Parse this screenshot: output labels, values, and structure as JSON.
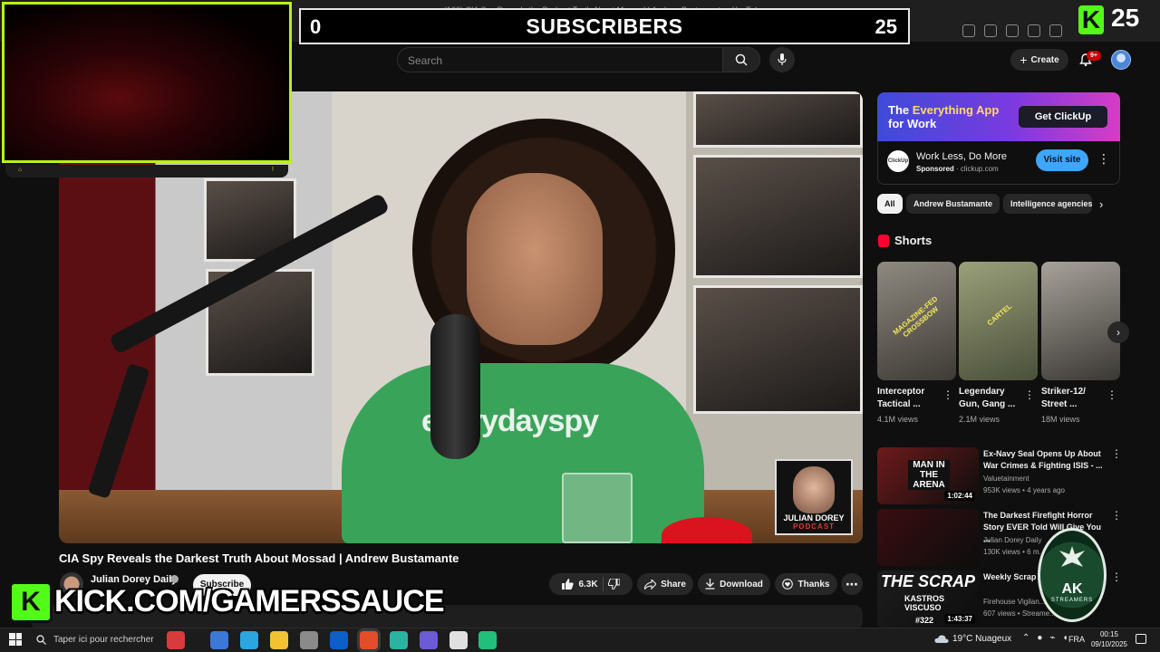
{
  "browser": {
    "tab_title": "(166) CIA Spy Reveals the Darkest Truth About Mossad | Andrew Bustamante - YouTube"
  },
  "youtube": {
    "search_placeholder": "Search",
    "create_label": "Create",
    "notifications_badge": "9+"
  },
  "video": {
    "title": "CIA Spy Reveals the Darkest Truth About Mossad | Andrew Bustamante",
    "shirt_text": "everydayspy",
    "podcast_logo_line1": "JULIAN DOREY",
    "podcast_logo_line2": "PODCAST",
    "channel": "Julian Dorey Daily",
    "subscribe_label": "Subscribe",
    "likes": "6.3K",
    "share_label": "Share",
    "download_label": "Download",
    "thanks_label": "Thanks"
  },
  "ad": {
    "headline_prefix": "The ",
    "headline_highlight": "Everything App",
    "headline_suffix": " for Work",
    "cta": "Get ClickUp",
    "logo_text": "ClickUp",
    "title": "Work Less, Do More",
    "sponsored": "Sponsored",
    "domain": "clickup.com",
    "visit_label": "Visit site"
  },
  "chips": [
    "All",
    "Andrew Bustamante",
    "Intelligence agencies"
  ],
  "shorts": {
    "heading": "Shorts",
    "items": [
      {
        "title": "Interceptor Tactical ...",
        "views": "4.1M views",
        "thumb_text": "MAGAZINE-FED CROSSBOW",
        "color_a": "#8f8a80",
        "color_b": "#3e3a35"
      },
      {
        "title": "Legendary Gun, Gang ...",
        "views": "2.1M views",
        "thumb_text": "CARTEL",
        "color_a": "#9aa07a",
        "color_b": "#4a4f3a"
      },
      {
        "title": "Striker-12/ Street ...",
        "views": "18M views",
        "thumb_text": "",
        "color_a": "#a7a29a",
        "color_b": "#3a3834"
      }
    ]
  },
  "related": [
    {
      "title": "Ex-Navy Seal Opens Up About War Crimes & Fighting ISIS - ...",
      "channel": "Valuetainment",
      "meta": "953K views • 4 years ago",
      "duration": "1:02:44",
      "thumb_text": "MAN IN THE ARENA",
      "thumb_bg": "#6d1a1a"
    },
    {
      "title": "The Darkest Firefight Horror Story EVER Told Will Give You ...",
      "channel": "Julian Dorey Daily",
      "meta": "130K views • 6 m...",
      "duration": "",
      "thumb_text": "",
      "thumb_bg": "#3a0d10"
    },
    {
      "title": "Weekly Scrap Visuso a lead...",
      "channel": "Firehouse Vigilan...",
      "meta": "607 views • Streame...",
      "duration": "1:43:37",
      "thumb_text": "THE SCRAP",
      "thumb_text_2": "KASTROS VISCUSO",
      "thumb_text_3": "#322",
      "thumb_bg": "#1d1d1d"
    }
  ],
  "overlays": {
    "subs_left": "0",
    "subs_label": "SUBSCRIBERS",
    "subs_right": "25",
    "kick_count": "25",
    "kick_letter": "K",
    "kick_url": "KICK.COM/GAMERSSAUCE",
    "webcam_left": "⌂",
    "webcam_right": "!",
    "ak_logo": "AK",
    "ak_sub": "STREAMERS"
  },
  "taskbar": {
    "search_placeholder": "Taper ici pour rechercher",
    "weather_temp": "19°C",
    "weather_desc": "Nuageux",
    "lang": "FRA",
    "time": "00:15",
    "date": "09/10/2025",
    "app_colors": [
      "#d83b3b",
      "#3b78d8",
      "#2aa6e0",
      "#f1c232",
      "#8a8a8a",
      "#0b5fc9",
      "#e24d2b",
      "#29b3a0",
      "#6b5bd6",
      "#e0e0e0",
      "#20c07a"
    ]
  }
}
